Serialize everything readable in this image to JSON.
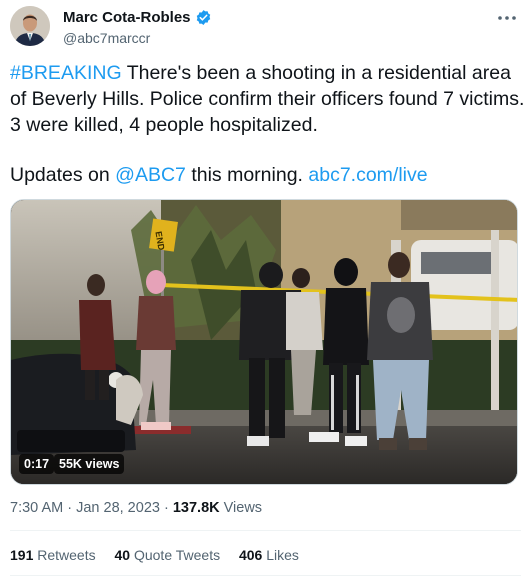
{
  "author": {
    "name": "Marc Cota-Robles",
    "handle": "@abc7marccr",
    "verified_icon": "verified-badge-icon",
    "verified_color": "#1d9bf0"
  },
  "tweet": {
    "hashtag": "#BREAKING",
    "line1_rest": " There's been a shooting in a residential area of Beverly Hills. Police confirm their officers found 7 victims. 3 were killed, 4 people hospitalized.",
    "line2_prefix": "Updates on ",
    "mention": "@ABC7",
    "line2_mid": " this morning. ",
    "link": "abc7.com/live",
    "link_color": "#1d9bf0"
  },
  "media": {
    "duration": "0:17",
    "views": "55K views",
    "sign_text": "END"
  },
  "meta": {
    "time": "7:30 AM",
    "separator": " · ",
    "date": "Jan 28, 2023",
    "view_count": "137.8K",
    "view_label": " Views"
  },
  "stats": {
    "retweets_count": "191",
    "retweets_label": " Retweets",
    "quotes_count": "40",
    "quotes_label": " Quote Tweets",
    "likes_count": "406",
    "likes_label": " Likes"
  }
}
